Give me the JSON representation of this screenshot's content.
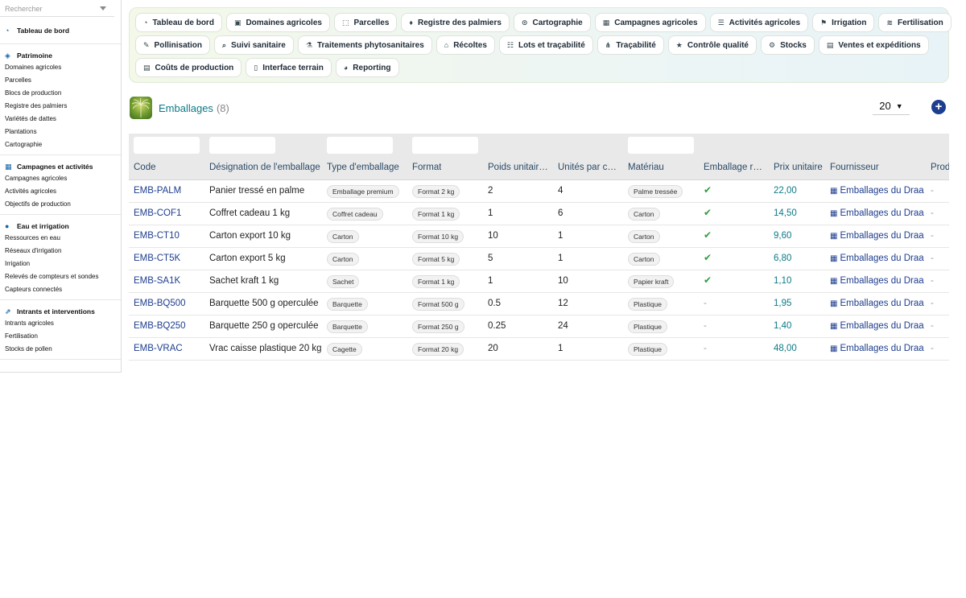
{
  "sidebar": {
    "search_placeholder": "Rechercher",
    "dashboard": "Tableau de bord",
    "sections": [
      {
        "title": "Patrimoine",
        "items": [
          "Domaines agricoles",
          "Parcelles",
          "Blocs de production",
          "Registre des palmiers",
          "Variétés de dattes",
          "Plantations",
          "Cartographie"
        ]
      },
      {
        "title": "Campagnes et activités",
        "items": [
          "Campagnes agricoles",
          "Activités agricoles",
          "Objectifs de production"
        ]
      },
      {
        "title": "Eau et irrigation",
        "items": [
          "Ressources en eau",
          "Réseaux d'irrigation",
          "Irrigation",
          "Relevés de compteurs et sondes",
          "Capteurs connectés"
        ]
      },
      {
        "title": "Intrants et interventions",
        "items": [
          "Intrants agricoles",
          "Fertilisation",
          "Stocks de pollen"
        ]
      }
    ]
  },
  "nav": {
    "row1": [
      "Tableau de bord",
      "Domaines agricoles",
      "Parcelles",
      "Registre des palmiers",
      "Cartographie",
      "Campagnes agricoles",
      "Activités agricoles",
      "Irrigation",
      "Fertilisation"
    ],
    "row2": [
      "Pollinisation",
      "Suivi sanitaire",
      "Traitements phytosanitaires",
      "Récoltes",
      "Lots et traçabilité",
      "Traçabilité",
      "Contrôle qualité",
      "Stocks",
      "Ventes et expéditions"
    ],
    "row3": [
      "Coûts de production",
      "Interface terrain",
      "Reporting"
    ]
  },
  "page": {
    "title": "Emballages",
    "count": "(8)",
    "per_page": "20",
    "add_icon": "plus-circle-icon"
  },
  "table": {
    "columns": [
      "Code",
      "Désignation de l'emballage",
      "Type d'emballage",
      "Format",
      "Poids unitair…",
      "Unités par c…",
      "Matériau",
      "Emballage r…",
      "Prix unitaire",
      "Fournisseur",
      "Prod"
    ],
    "rows": [
      {
        "code": "EMB-PALM",
        "designation": "Panier tressé en palme",
        "type": "Emballage premium",
        "format": "Format 2 kg",
        "poids": "2",
        "unites": "4",
        "materiau": "Palme tressée",
        "reutil": true,
        "prix": "22,00",
        "fournisseur": "Emballages du Draa",
        "prod": "-"
      },
      {
        "code": "EMB-COF1",
        "designation": "Coffret cadeau 1 kg",
        "type": "Coffret cadeau",
        "format": "Format 1 kg",
        "poids": "1",
        "unites": "6",
        "materiau": "Carton",
        "reutil": true,
        "prix": "14,50",
        "fournisseur": "Emballages du Draa",
        "prod": "-"
      },
      {
        "code": "EMB-CT10",
        "designation": "Carton export 10 kg",
        "type": "Carton",
        "format": "Format 10 kg",
        "poids": "10",
        "unites": "1",
        "materiau": "Carton",
        "reutil": true,
        "prix": "9,60",
        "fournisseur": "Emballages du Draa",
        "prod": "-"
      },
      {
        "code": "EMB-CT5K",
        "designation": "Carton export 5 kg",
        "type": "Carton",
        "format": "Format 5 kg",
        "poids": "5",
        "unites": "1",
        "materiau": "Carton",
        "reutil": true,
        "prix": "6,80",
        "fournisseur": "Emballages du Draa",
        "prod": "-"
      },
      {
        "code": "EMB-SA1K",
        "designation": "Sachet kraft 1 kg",
        "type": "Sachet",
        "format": "Format 1 kg",
        "poids": "1",
        "unites": "10",
        "materiau": "Papier kraft",
        "reutil": true,
        "prix": "1,10",
        "fournisseur": "Emballages du Draa",
        "prod": "-"
      },
      {
        "code": "EMB-BQ500",
        "designation": "Barquette 500 g operculée",
        "type": "Barquette",
        "format": "Format 500 g",
        "poids": "0.5",
        "unites": "12",
        "materiau": "Plastique",
        "reutil": false,
        "prix": "1,95",
        "fournisseur": "Emballages du Draa",
        "prod": "-"
      },
      {
        "code": "EMB-BQ250",
        "designation": "Barquette 250 g operculée",
        "type": "Barquette",
        "format": "Format 250 g",
        "poids": "0.25",
        "unites": "24",
        "materiau": "Plastique",
        "reutil": false,
        "prix": "1,40",
        "fournisseur": "Emballages du Draa",
        "prod": "-"
      },
      {
        "code": "EMB-VRAC",
        "designation": "Vrac caisse plastique 20 kg",
        "type": "Cagette",
        "format": "Format 20 kg",
        "poids": "20",
        "unites": "1",
        "materiau": "Plastique",
        "reutil": false,
        "prix": "48,00",
        "fournisseur": "Emballages du Draa",
        "prod": "-"
      }
    ],
    "empty_mark": "-"
  },
  "colors": {
    "accent": "#0b7a86",
    "link": "#1d3d8e",
    "check": "#2e9e3c"
  }
}
